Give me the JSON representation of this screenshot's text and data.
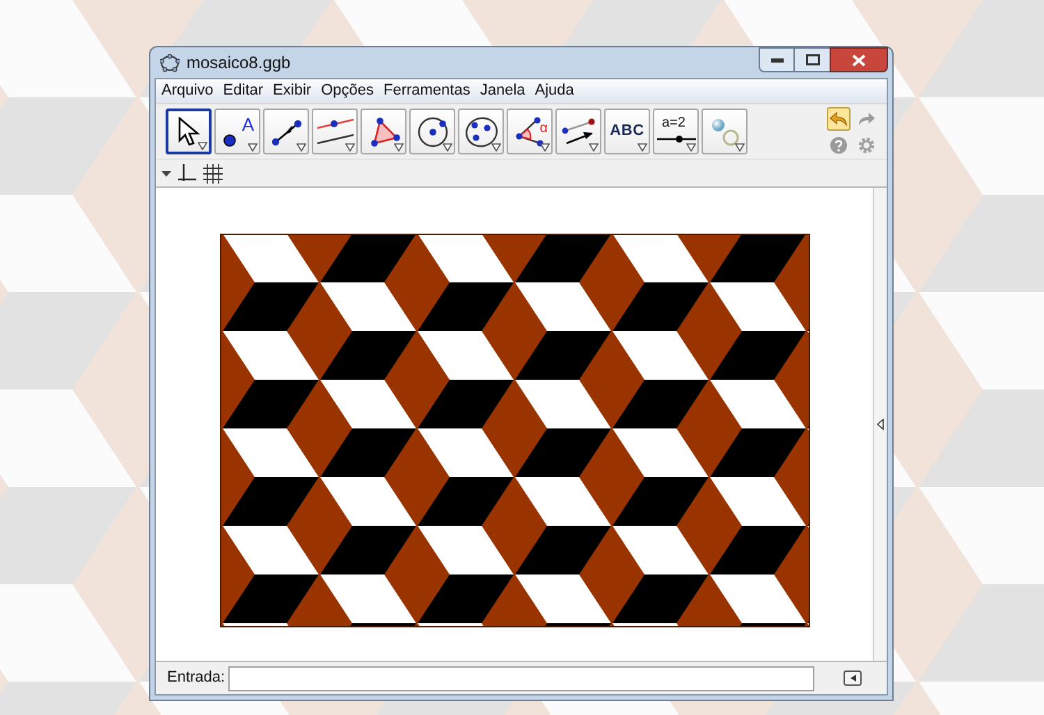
{
  "window": {
    "title": "mosaico8.ggb"
  },
  "menu": [
    "Arquivo",
    "Editar",
    "Exibir",
    "Opções",
    "Ferramentas",
    "Janela",
    "Ajuda"
  ],
  "toolbar": [
    {
      "kind": "move",
      "selected": true
    },
    {
      "kind": "point",
      "selected": false,
      "label": "A"
    },
    {
      "kind": "line",
      "selected": false
    },
    {
      "kind": "perpendicular",
      "selected": false
    },
    {
      "kind": "polygon",
      "selected": false
    },
    {
      "kind": "circle",
      "selected": false
    },
    {
      "kind": "conic",
      "selected": false
    },
    {
      "kind": "angle",
      "selected": false,
      "label": "α"
    },
    {
      "kind": "reflect",
      "selected": false
    },
    {
      "kind": "text",
      "selected": false,
      "label": "ABC"
    },
    {
      "kind": "slider",
      "selected": false,
      "label": "a=2"
    },
    {
      "kind": "showhide",
      "selected": false
    }
  ],
  "input_bar": {
    "label": "Entrada:"
  }
}
